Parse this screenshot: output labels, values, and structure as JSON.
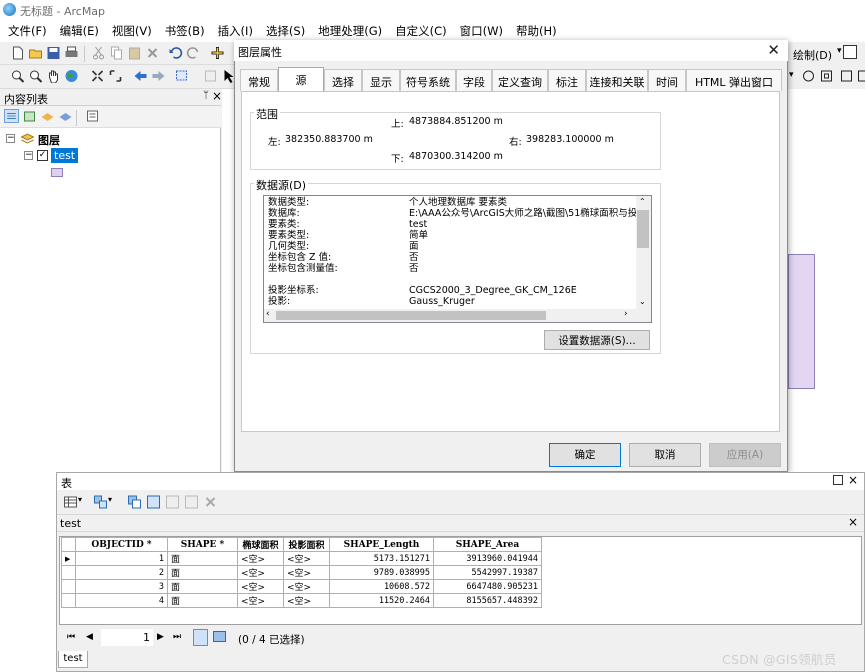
{
  "app": {
    "title": "无标题 - ArcMap"
  },
  "menu": [
    "文件(F)",
    "编辑(E)",
    "视图(V)",
    "书签(B)",
    "插入(I)",
    "选择(S)",
    "地理处理(G)",
    "自定义(C)",
    "窗口(W)",
    "帮助(H)"
  ],
  "right_toolbar": {
    "draw_label": "绘制(D)"
  },
  "toc": {
    "title": "内容列表",
    "pin": "ᛘ",
    "close": "×",
    "root_label": "图层",
    "layer_name": "test",
    "layer_checked": true,
    "layer_color": "#ddd1f0"
  },
  "dialog": {
    "title": "图层属性",
    "tabs": [
      "常规",
      "源",
      "选择",
      "显示",
      "符号系统",
      "字段",
      "定义查询",
      "标注",
      "连接和关联",
      "时间",
      "HTML 弹出窗口"
    ],
    "active_tab": "源",
    "extent": {
      "label": "范围",
      "top_label": "上:",
      "top": "4873884.851200 m",
      "left_label": "左:",
      "left": "382350.883700 m",
      "right_label": "右:",
      "right": "398283.100000 m",
      "bottom_label": "下:",
      "bottom": "4870300.314200 m"
    },
    "source": {
      "label": "数据源(D)",
      "rows": [
        {
          "k": "数据类型:",
          "v": "个人地理数据库 要素类"
        },
        {
          "k": "数据库:",
          "v": "E:\\AAA公众号\\ArcGIS大师之路\\截图\\51椭球面积与投"
        },
        {
          "k": "要素类:",
          "v": "test"
        },
        {
          "k": "要素类型:",
          "v": "简单"
        },
        {
          "k": "几何类型:",
          "v": "面"
        },
        {
          "k": "坐标包含 Z 值:",
          "v": "否"
        },
        {
          "k": "坐标包含测量值:",
          "v": "否"
        },
        {
          "k": "",
          "v": ""
        },
        {
          "k": "投影坐标系:",
          "v": "CGCS2000_3_Degree_GK_CM_126E"
        },
        {
          "k": "投影:",
          "v": "Gauss_Kruger"
        }
      ]
    },
    "set_source_button": "设置数据源(S)...",
    "ok_button": "确定",
    "cancel_button": "取消",
    "apply_button": "应用(A)"
  },
  "table": {
    "window_title": "表",
    "tab_label": "test",
    "columns": [
      "OBJECTID *",
      "SHAPE *",
      "椭球面积",
      "投影面积",
      "SHAPE_Length",
      "SHAPE_Area"
    ],
    "rows": [
      [
        "1",
        "面",
        "<空>",
        "<空>",
        "5173.151271",
        "3913960.041944"
      ],
      [
        "2",
        "面",
        "<空>",
        "<空>",
        "9789.038995",
        "5542997.19387"
      ],
      [
        "3",
        "面",
        "<空>",
        "<空>",
        "10608.572",
        "6647480.905231"
      ],
      [
        "4",
        "面",
        "<空>",
        "<空>",
        "11520.2464",
        "8155657.448392"
      ]
    ],
    "current_record": "1",
    "selection_status": "(0 / 4 已选择)",
    "bottom_tab": "test"
  },
  "watermark": "CSDN @GIS领航员"
}
